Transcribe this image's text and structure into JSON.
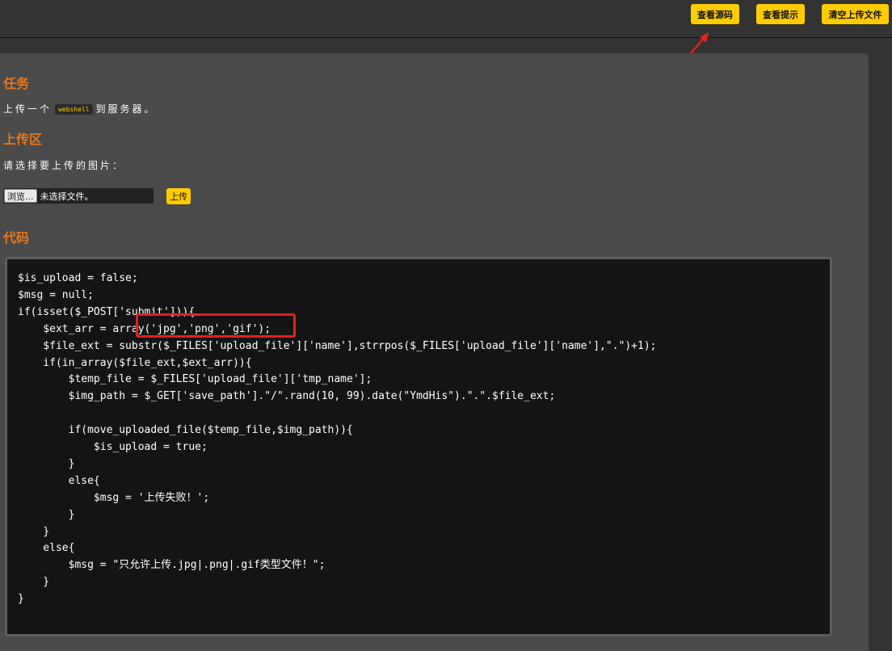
{
  "toolbar": {
    "view_source_label": "查看源码",
    "view_hint_label": "查看提示",
    "clear_uploads_label": "清空上传文件"
  },
  "task": {
    "heading": "任务",
    "text_before": "上传一个",
    "inline_code": "webshell",
    "text_after": "到服务器。"
  },
  "upload": {
    "heading": "上传区",
    "prompt": "请选择要上传的图片：",
    "browse_label": "浏览...",
    "file_status": "未选择文件。",
    "submit_label": "上传"
  },
  "code": {
    "heading": "代码",
    "lines": [
      "$is_upload = false;",
      "$msg = null;",
      "if(isset($_POST['submit'])){",
      "    $ext_arr = array('jpg','png','gif');",
      "    $file_ext = substr($_FILES['upload_file']['name'],strrpos($_FILES['upload_file']['name'],\".\")+1);",
      "    if(in_array($file_ext,$ext_arr)){",
      "        $temp_file = $_FILES['upload_file']['tmp_name'];",
      "        $img_path = $_GET['save_path'].\"/\".rand(10, 99).date(\"YmdHis\").\".\".$file_ext;",
      "",
      "        if(move_uploaded_file($temp_file,$img_path)){",
      "            $is_upload = true;",
      "        }",
      "        else{",
      "            $msg = '上传失败！';",
      "        }",
      "    }",
      "    else{",
      "        $msg = \"只允许上传.jpg|.png|.gif类型文件！\";",
      "    }",
      "}"
    ]
  },
  "colors": {
    "accent": "#ffcc00",
    "heading": "#e8761c",
    "annotation": "#e32020"
  }
}
